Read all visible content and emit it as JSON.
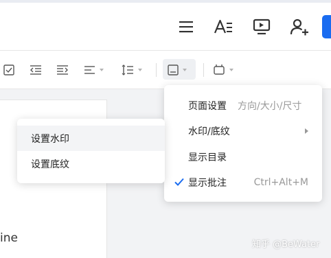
{
  "header": {
    "icons": [
      "menu-icon",
      "text-format-icon",
      "present-icon",
      "add-user-icon"
    ]
  },
  "toolbar": {
    "icons": [
      "checkbox-icon",
      "outdent-icon",
      "indent-icon",
      "align-icon",
      "line-spacing-icon",
      "page-layout-icon",
      "plugin-icon"
    ]
  },
  "document": {
    "partial_text": "ine"
  },
  "layout_menu": {
    "items": [
      {
        "label": "页面设置",
        "hint": "方向/大小/尺寸"
      },
      {
        "label": "水印/底纹",
        "has_submenu": true
      },
      {
        "label": "显示目录"
      },
      {
        "label": "显示批注",
        "checked": true,
        "shortcut": "Ctrl+Alt+M"
      }
    ]
  },
  "watermark_submenu": {
    "items": [
      {
        "label": "设置水印"
      },
      {
        "label": "设置底纹"
      }
    ]
  },
  "watermark": "知乎 @BeWater",
  "colors": {
    "accent": "#1a6cf0",
    "check": "#1a6cf0",
    "hint": "#999999"
  }
}
